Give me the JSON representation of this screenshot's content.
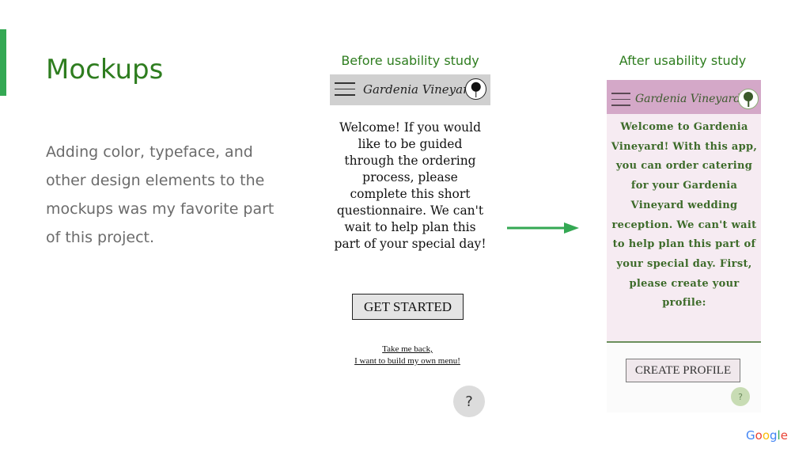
{
  "slide": {
    "title": "Mockups",
    "body": "Adding color, typeface, and other design elements to the mockups was my favorite part of this project."
  },
  "before": {
    "caption": "Before usability study",
    "brand": "Gardenia Vineyard",
    "welcome": "Welcome! If you would like to be guided through the ordering process, please complete this short questionnaire. We can't wait to help plan this part of your special day!",
    "button": "GET STARTED",
    "link_line1": "Take me back,",
    "link_line2": "I want to build my own menu!",
    "help": "?"
  },
  "after": {
    "caption": "After usability study",
    "brand": "Gardenia Vineyard",
    "welcome": "Welcome to Gardenia Vineyard! With this app, you can order catering for your Gardenia Vineyard wedding reception. We can't wait to help plan this part of your special day. First, please create your profile:",
    "button": "CREATE PROFILE",
    "help": "?"
  },
  "footer": {
    "logo_letters": [
      "G",
      "o",
      "o",
      "g",
      "l",
      "e"
    ]
  },
  "colors": {
    "accent": "#34a853",
    "title_green": "#2e7d1f",
    "mauve_header": "#d4a8c8",
    "pink_body": "#f6ebf2",
    "google_blue": "#4285f4",
    "google_red": "#ea4335",
    "google_yellow": "#fbbc05",
    "google_green": "#34a853"
  }
}
